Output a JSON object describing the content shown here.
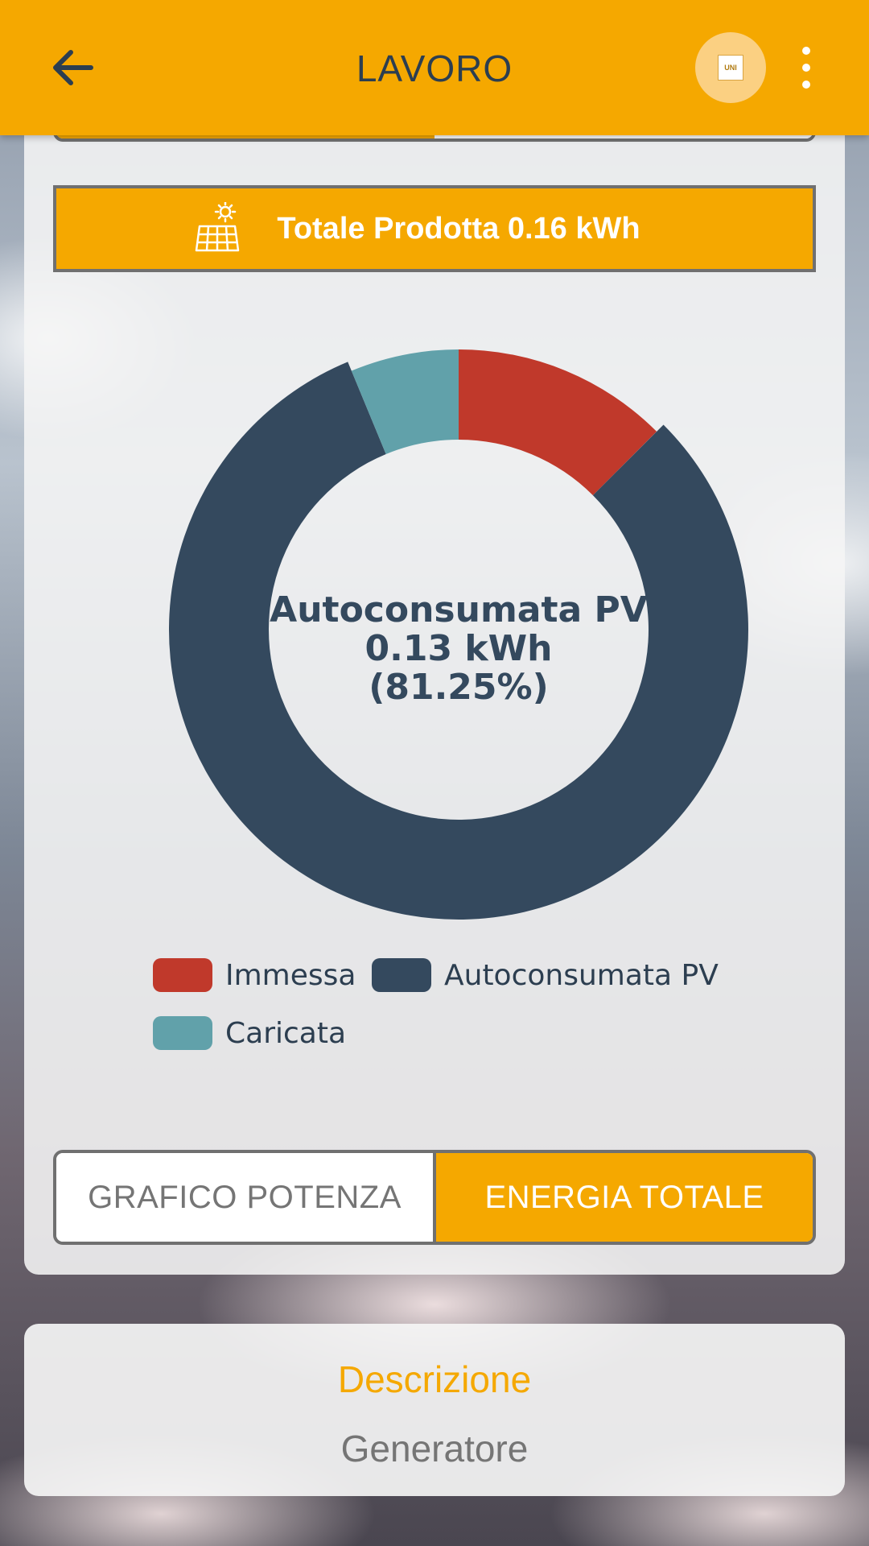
{
  "appbar": {
    "title": "LAVORO",
    "logo_text": "UNI SOLAR GROUP",
    "accent_color": "#f5a800"
  },
  "banner": {
    "icon": "solar-panel-icon",
    "text": "Totale Prodotta 0.16 kWh"
  },
  "chart_data": {
    "type": "pie",
    "variant": "donut",
    "categories": [
      "Immessa",
      "Autoconsumata PV",
      "Caricata"
    ],
    "values": [
      12.5,
      81.25,
      6.25
    ],
    "colors": [
      "#c0392b",
      "#34495e",
      "#61a1aa"
    ],
    "highlighted": "Autoconsumata PV",
    "center_label": {
      "name": "Autoconsumata PV",
      "value": "0.13 kWh",
      "percent": "(81.25%)"
    },
    "legend_position": "bottom"
  },
  "toggle": {
    "left_label": "GRAFICO POTENZA",
    "right_label": "ENERGIA TOTALE",
    "selected": "right"
  },
  "description": {
    "label": "Descrizione",
    "value": "Generatore"
  }
}
